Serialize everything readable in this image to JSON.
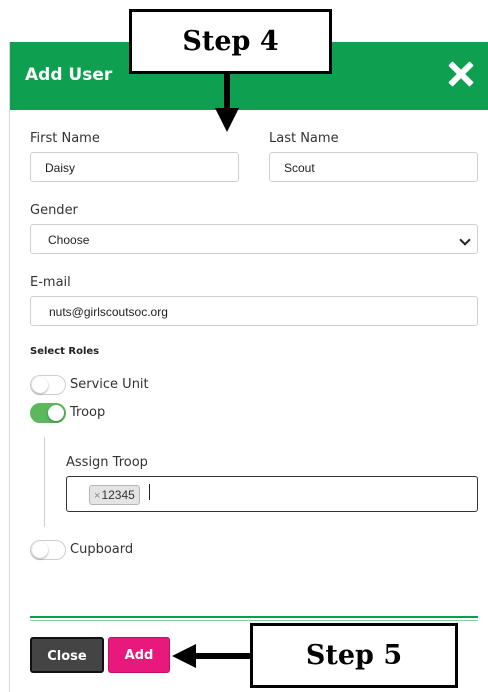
{
  "modal": {
    "title": "Add User",
    "close_icon": "close-icon"
  },
  "form": {
    "first_name": {
      "label": "First Name",
      "value": "Daisy"
    },
    "last_name": {
      "label": "Last Name",
      "value": "Scout"
    },
    "gender": {
      "label": "Gender",
      "selected": "Choose"
    },
    "email": {
      "label": "E-mail",
      "value": "nuts@girlscoutsoc.org"
    }
  },
  "roles": {
    "title": "Select Roles",
    "items": [
      {
        "label": "Service Unit",
        "checked": false
      },
      {
        "label": "Troop",
        "checked": true
      },
      {
        "label": "Cupboard",
        "checked": false
      }
    ],
    "assign_troop": {
      "label": "Assign Troop",
      "chip_remove": "×",
      "chip_value": "12345"
    }
  },
  "buttons": {
    "close_label": "Close",
    "add_label": "Add"
  },
  "annotations": {
    "step4": "Step 4",
    "step5": "Step 5"
  },
  "colors": {
    "header": "#0f9f50",
    "add_button": "#e8187d",
    "toggle_on": "#5cb85c"
  }
}
